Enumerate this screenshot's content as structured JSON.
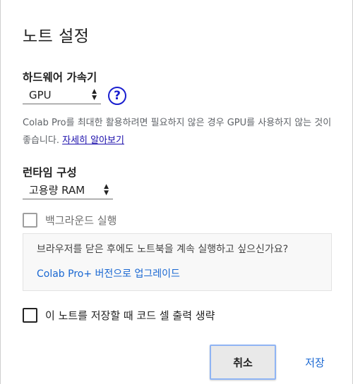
{
  "dialog": {
    "title": "노트 설정"
  },
  "hardware": {
    "heading": "하드웨어 가속기",
    "selected": "GPU",
    "help_symbol": "?",
    "description": "Colab Pro를 최대한 활용하려면 필요하지 않은 경우 GPU를 사용하지 않는 것이 좋습니다. ",
    "learn_more": "자세히 알아보기"
  },
  "runtime": {
    "heading": "런타임 구성",
    "selected": "고용량 RAM"
  },
  "background": {
    "label": "백그라운드 실행",
    "checked": false
  },
  "promo": {
    "text": "브라우저를 닫은 후에도 노트북을 계속 실행하고 싶으신가요?",
    "link": "Colab Pro+ 버전으로 업그레이드"
  },
  "omit_output": {
    "label": "이 노트를 저장할 때 코드 셀 출력 생략",
    "checked": false
  },
  "buttons": {
    "cancel": "취소",
    "save": "저장"
  },
  "colors": {
    "link": "#1967d2",
    "help_icon": "#1a1fcf",
    "focus_border": "#8fb4f4"
  }
}
